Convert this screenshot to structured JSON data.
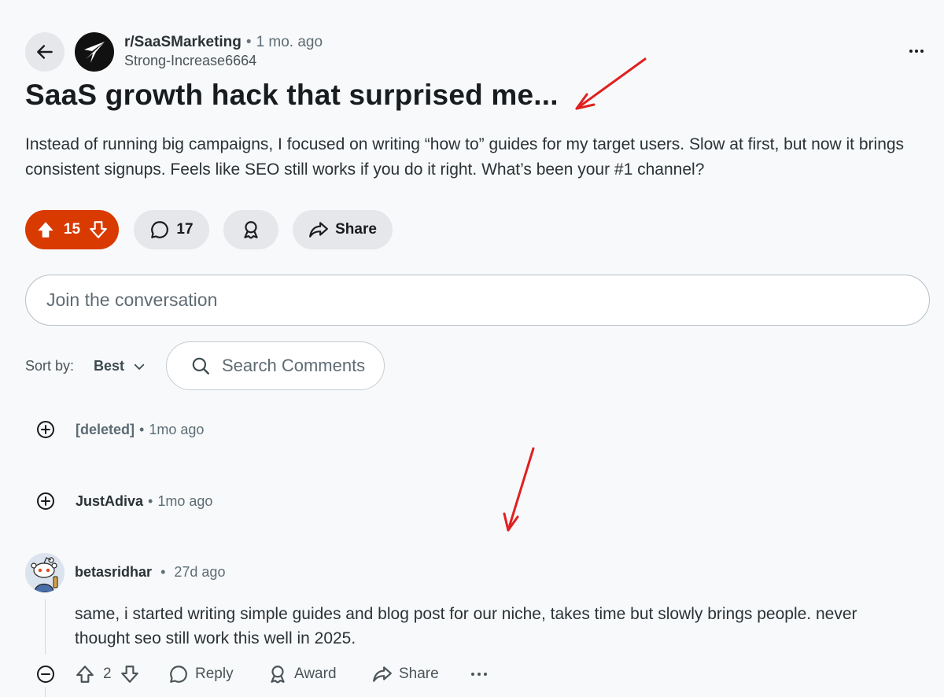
{
  "post": {
    "subreddit": "r/SaaSMarketing",
    "separator": "•",
    "age": "1 mo. ago",
    "author": "Strong-Increase6664",
    "title": "SaaS growth hack that surprised me...",
    "body": "Instead of running big campaigns, I focused on writing “how to” guides for my target users. Slow at first, but now it brings consistent signups. Feels like SEO still works if you do it right. What’s been your #1 channel?"
  },
  "actions": {
    "votes": "15",
    "comments": "17",
    "share_label": "Share"
  },
  "composer": {
    "placeholder": "Join the conversation"
  },
  "sort": {
    "label": "Sort by:",
    "value": "Best"
  },
  "search": {
    "placeholder": "Search Comments"
  },
  "comments": [
    {
      "author": "[deleted]",
      "separator": "•",
      "time": "1mo ago"
    },
    {
      "author": "JustAdiva",
      "separator": "•",
      "time": "1mo ago"
    },
    {
      "author": "betasridhar",
      "separator": "•",
      "time": "27d ago",
      "text": "same, i started writing simple guides and blog post for our niche, takes time but slowly brings people. never thought seo still work this well in 2025.",
      "votes": "2",
      "reply_label": "Reply",
      "award_label": "Award",
      "share_label": "Share"
    }
  ],
  "colors": {
    "upvote_active": "#d93a00",
    "pill_bg": "#e5e7eb",
    "annotation": "#e02020"
  },
  "icons": [
    "back-arrow-icon",
    "subreddit-logo-icon",
    "more-icon",
    "upvote-icon",
    "downvote-icon",
    "comment-icon",
    "award-icon",
    "share-icon",
    "search-icon",
    "chevron-down-icon",
    "expand-plus-icon",
    "collapse-minus-icon",
    "snoo-avatar-icon"
  ]
}
